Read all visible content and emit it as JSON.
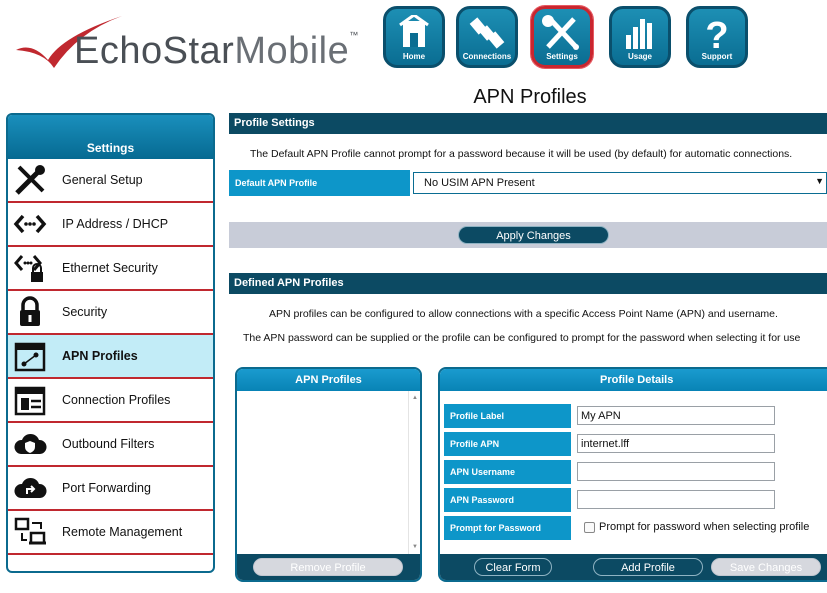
{
  "brand": {
    "name_part1": "EchoStar",
    "name_part2": "Mobile",
    "tm": "™",
    "accent": "#c0282f"
  },
  "nav": [
    {
      "label": "Home",
      "icon": "home-icon"
    },
    {
      "label": "Connections",
      "icon": "satellite-icon"
    },
    {
      "label": "Settings",
      "icon": "tools-icon",
      "active": true
    },
    {
      "label": "Usage",
      "icon": "bar-chart-icon"
    },
    {
      "label": "Support",
      "icon": "question-icon"
    }
  ],
  "page": {
    "title": "APN Profiles"
  },
  "sidebar": {
    "title": "Settings",
    "items": [
      {
        "label": "General Setup",
        "icon": "tools-icon"
      },
      {
        "label": "IP Address / DHCP",
        "icon": "network-arrows-icon"
      },
      {
        "label": "Ethernet Security",
        "icon": "network-lock-icon"
      },
      {
        "label": "Security",
        "icon": "padlock-icon"
      },
      {
        "label": "APN Profiles",
        "icon": "apn-calendar-icon",
        "active": true
      },
      {
        "label": "Connection Profiles",
        "icon": "connection-calendar-icon"
      },
      {
        "label": "Outbound Filters",
        "icon": "cloud-shield-icon"
      },
      {
        "label": "Port Forwarding",
        "icon": "cloud-share-icon"
      },
      {
        "label": "Remote Management",
        "icon": "remote-devices-icon"
      }
    ]
  },
  "profile_settings": {
    "header": "Profile Settings",
    "note": "The Default APN Profile cannot prompt for a password because it will be used (by default) for automatic connections.",
    "default_label": "Default APN Profile",
    "default_value": "No USIM APN Present",
    "apply_label": "Apply Changes"
  },
  "defined": {
    "header": "Defined APN Profiles",
    "note1": "APN profiles can be configured to allow connections with a specific Access Point Name (APN) and username.",
    "note2": "The APN password can be supplied or the profile can be configured to prompt for the password when selecting it for use"
  },
  "apn_list": {
    "title": "APN Profiles",
    "remove_label": "Remove Profile"
  },
  "details": {
    "title": "Profile Details",
    "profile_label_label": "Profile Label",
    "profile_label_value": "My APN",
    "profile_apn_label": "Profile APN",
    "profile_apn_value": "internet.lff",
    "username_label": "APN Username",
    "username_value": "",
    "password_label": "APN Password",
    "password_value": "",
    "prompt_label": "Prompt for Password",
    "prompt_check_label": "Prompt for password when selecting profile",
    "prompt_checked": false,
    "clear_label": "Clear Form",
    "add_label": "Add Profile",
    "save_label": "Save Changes"
  }
}
